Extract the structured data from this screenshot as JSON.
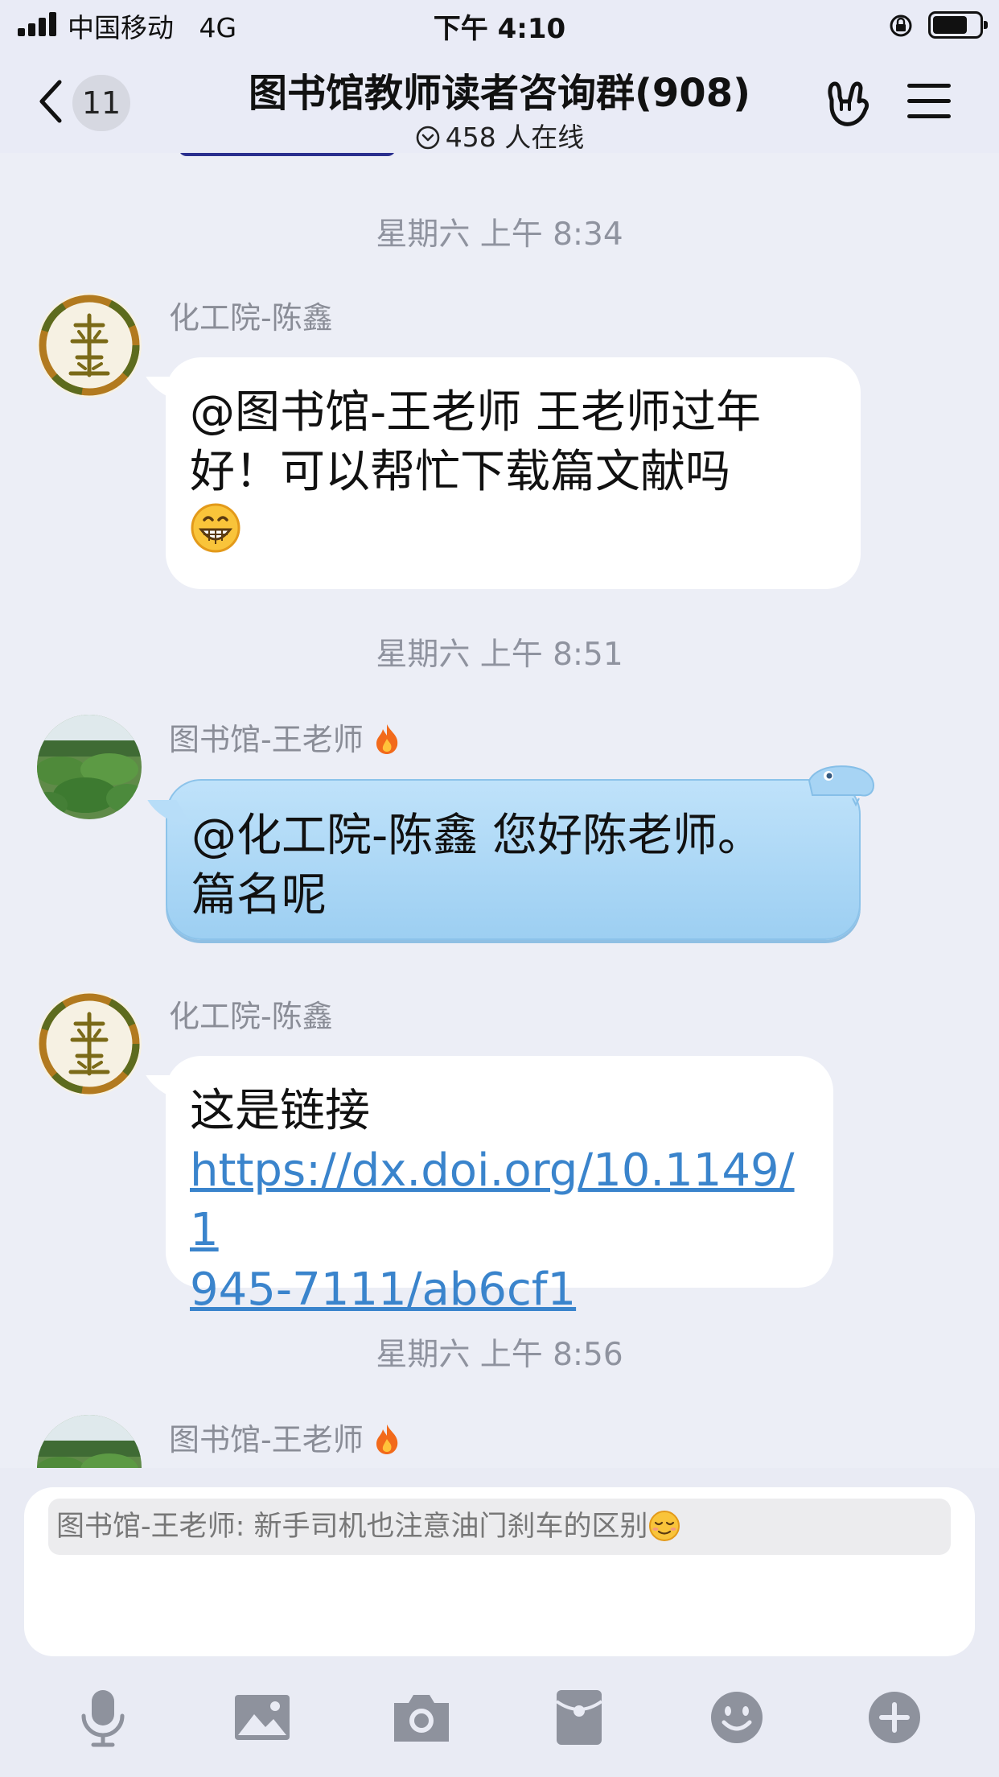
{
  "status_bar": {
    "carrier": "中国移动",
    "network": "4G",
    "time": "下午 4:10",
    "battery_level": 0.75
  },
  "header": {
    "unread_count": "11",
    "title": "图书馆教师读者咨询群(908)",
    "online": "458 人在线"
  },
  "timestamps": [
    "星期六 上午 8:34",
    "星期六 上午 8:51",
    "星期六 上午 8:56"
  ],
  "messages": [
    {
      "sender": "化工院-陈鑫",
      "avatar": "emblem-avatar",
      "lines": [
        "@图书馆-王老师 王老师过年",
        "好！可以帮忙下载篇文献吗"
      ],
      "emoji": "grinning-face"
    },
    {
      "sender": "图书馆-王老师",
      "avatar": "lotus-avatar",
      "badge": "flame-icon",
      "lines": [
        "@化工院-陈鑫 您好陈老师。",
        "篇名呢"
      ]
    },
    {
      "sender": "化工院-陈鑫",
      "avatar": "emblem-avatar",
      "text": "这是链接",
      "link_lines": [
        "https://dx.doi.org/10.1149/1",
        "945-7111/ab6cf1"
      ]
    },
    {
      "sender": "图书馆-王老师",
      "avatar": "lotus-avatar",
      "badge": "flame-icon"
    }
  ],
  "input": {
    "draft_quote": "图书馆-王老师: 新手司机也注意油门刹车的区别",
    "draft_emoji": "smiling-face"
  },
  "toolbar": [
    "microphone-icon",
    "image-icon",
    "camera-icon",
    "red-packet-icon",
    "emoji-icon",
    "plus-icon"
  ],
  "colors": {
    "background": "#eceef6",
    "bubble_white": "#ffffff",
    "bubble_blue": "#a9d6f5",
    "link": "#3a84cc",
    "timestamp": "#8f939f",
    "icon_gray": "#8e929d"
  }
}
